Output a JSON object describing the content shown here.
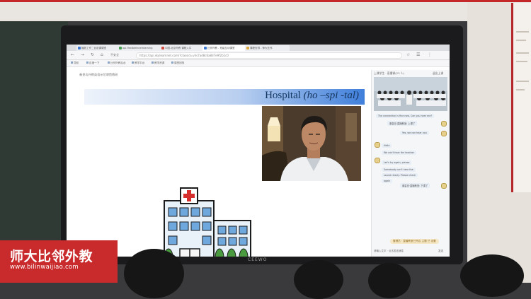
{
  "watermark": {
    "brand_cn": "师大比邻外教",
    "url": "www.bilinwaijiao.com",
    "color": "#c92a2c"
  },
  "monitor": {
    "brand": "CEEWO"
  },
  "browser": {
    "tabs": [
      {
        "label": "播放工作二台说课课堂",
        "favicon_color": "#3e7ad1"
      },
      {
        "label": "api.flexibleinnerlearning",
        "favicon_color": "#48a151"
      },
      {
        "label": "中国-北京外教 课程入口",
        "favicon_color": "#d14b3e"
      },
      {
        "label": "比邻外教 - 班级互动课堂",
        "favicon_color": "#3e7ad1"
      },
      {
        "label": "课程安排 - 师大比邻",
        "favicon_color": "#e0a93b"
      }
    ],
    "url": "https://api.skylearnnet.com/?classid=vhs7ad8c6a8d7e9f2b1c0",
    "secure_label": "不安全",
    "bookmarks": [
      "导航",
      "百度一下",
      "比邻外教后台",
      "教学平台",
      "教学资源",
      "课堂回放"
    ]
  },
  "page": {
    "breadcrumb": "秦皇岛外教英语示范课暨教研",
    "slide": {
      "title_word": "Hospital",
      "title_phonetic": "(ho –spi -tal)",
      "banner_color": "#3f7fdb"
    }
  },
  "side_panel": {
    "header_left": "上课学生 · 直播课(23 人)",
    "header_right": "退出上课",
    "messages": [
      {
        "text": "The connection is fine now. Can you hear me?"
      },
      {
        "text": "秦皇岛·直播教室: 上课了"
      },
      {
        "text": "Yes, we can hear you"
      },
      {
        "text": "Hello"
      },
      {
        "text": "We can't hear the teacher"
      },
      {
        "text": "Let's try again, please"
      },
      {
        "text": "Somebody can't hear the"
      },
      {
        "text": "sound clearly. Please check"
      },
      {
        "text": "again"
      },
      {
        "text": "秦皇岛·直播教室: 下课了"
      }
    ],
    "notice": "管理员 · 直播教室已开启 主题 已 设置",
    "input_placeholder": "请输入文字 · 点击发送消息",
    "send_label": "发送"
  }
}
